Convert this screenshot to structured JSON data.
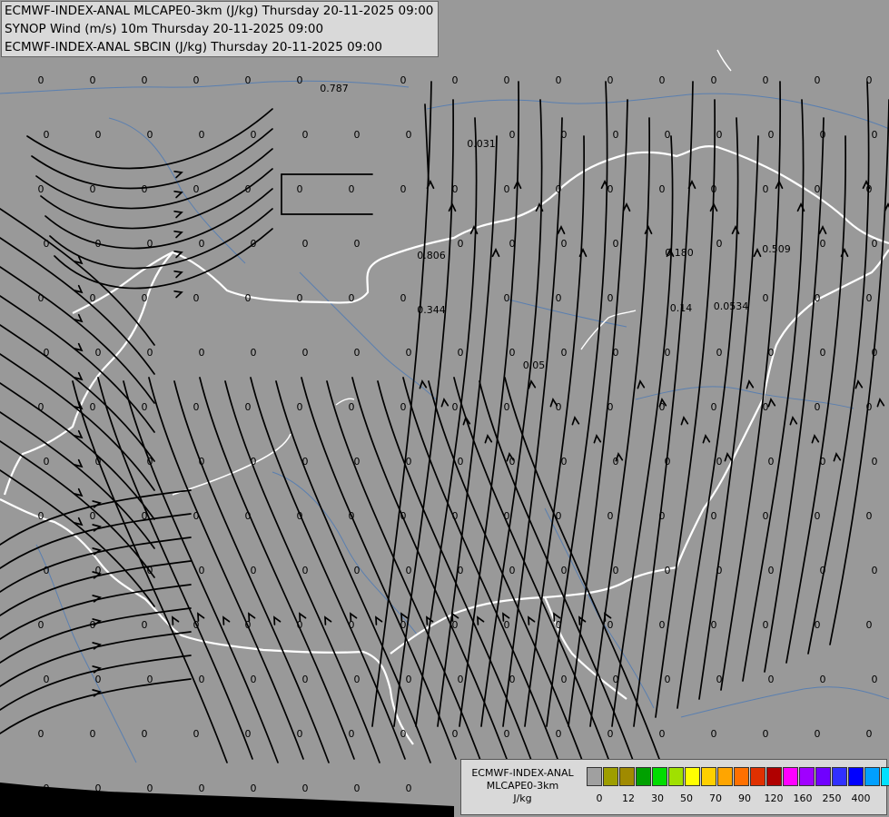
{
  "titles": [
    "ECMWF-INDEX-ANAL MLCAPE0-3km (J/kg) Thursday 20-11-2025 09:00",
    "SYNOP Wind (m/s) 10m Thursday 20-11-2025 09:00",
    "ECMWF-INDEX-ANAL SBCIN (J/kg) Thursday 20-11-2025 09:00"
  ],
  "legend": {
    "line1": "ECMWF-INDEX-ANAL",
    "line2": "MLCAPE0-3km",
    "unit": "J/kg",
    "colors": [
      "#a0a0a0",
      "#9e9e00",
      "#a08a00",
      "#00a000",
      "#00dd00",
      "#a0e000",
      "#ffff00",
      "#ffd000",
      "#ffa500",
      "#ff7000",
      "#e03000",
      "#b00000",
      "#ff00ff",
      "#a000ff",
      "#7000ff",
      "#3030ff",
      "#0000ff",
      "#00a0ff",
      "#00e0ff",
      "#80ffff",
      "#ffffff"
    ],
    "ticks": [
      "0",
      "12",
      "30",
      "50",
      "70",
      "90",
      "120",
      "160",
      "250",
      "400"
    ]
  },
  "map_values": {
    "special": [
      "0.787",
      "0.031",
      "0.806",
      "0.344",
      "0.180",
      "0.509",
      "0.05",
      "0.14",
      "0.0534"
    ],
    "zero": "0"
  },
  "colors": {
    "background": "#999999",
    "borders": "#ffffff",
    "rivers": "#5a7fb0",
    "streamlines": "#000000",
    "sea": "#000000"
  }
}
